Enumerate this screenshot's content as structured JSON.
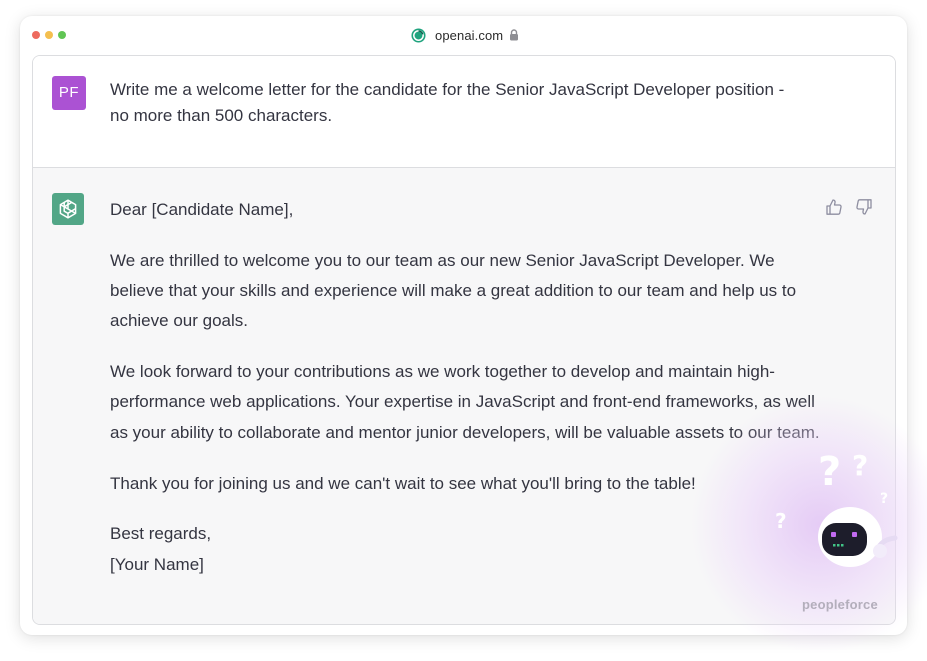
{
  "browser": {
    "url": "openai.com"
  },
  "conversation": {
    "user": {
      "avatar_initials": "PF",
      "message_line1": "Write me a welcome letter for the candidate for the Senior JavaScript Developer position -",
      "message_line2": "no more than 500 characters."
    },
    "assistant": {
      "greeting": "Dear [Candidate Name],",
      "paragraph1": "We are thrilled to welcome you to our team as our new Senior JavaScript Developer. We believe that your skills and experience will make a great addition to our team and help us to achieve our goals.",
      "paragraph2": "We look forward to your contributions as we work together to develop and maintain high-performance web applications. Your expertise in JavaScript and front-end frameworks, as well as your ability to collaborate and mentor junior developers, will be valuable assets to our team.",
      "paragraph3": "Thank you for joining us and we can't wait to see what you'll bring to the table!",
      "signoff": "Best regards,",
      "signature": "[Your Name]"
    }
  },
  "branding": {
    "watermark": "peopleforce"
  },
  "icons": {
    "site": "openai-logo-icon",
    "lock": "lock-icon",
    "assistant_avatar": "chatgpt-logo-icon",
    "like": "thumbs-up-icon",
    "dislike": "thumbs-down-icon"
  },
  "colors": {
    "user_avatar": "#ab52d3",
    "assistant_avatar": "#52a687",
    "assistant_bg": "#f7f7f8",
    "text": "#343541"
  }
}
